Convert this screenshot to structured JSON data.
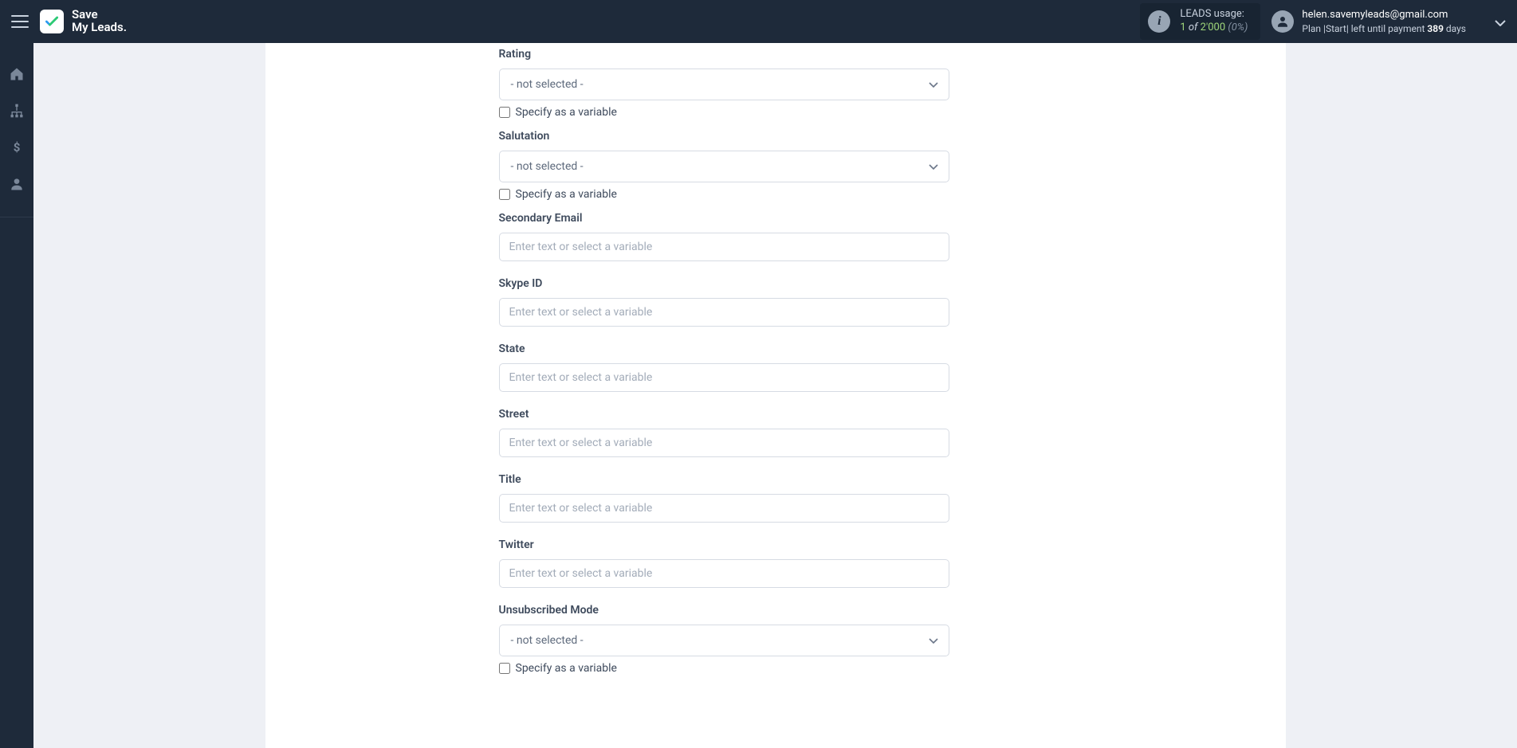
{
  "app": {
    "name_line1": "Save",
    "name_line2": "My Leads."
  },
  "header": {
    "usage_label": "LEADS usage:",
    "usage_current": "1",
    "usage_of": "of",
    "usage_total": "2'000",
    "usage_pct": "(0%)",
    "user_email": "helen.savemyleads@gmail.com",
    "plan_prefix": "Plan |",
    "plan_name": "Start",
    "plan_mid": "| left until payment ",
    "plan_days": "389",
    "plan_suffix": " days"
  },
  "form": {
    "placeholder_text": "Enter text or select a variable",
    "placeholder_dark": "Enter text",
    "placeholder_light": " or select a variable",
    "not_selected": "- not selected -",
    "specify_variable": "Specify as a variable",
    "fields": {
      "rating": "Rating",
      "salutation": "Salutation",
      "secondary_email": "Secondary Email",
      "skype_id": "Skype ID",
      "state": "State",
      "street": "Street",
      "title": "Title",
      "twitter": "Twitter",
      "unsubscribed_mode": "Unsubscribed Mode"
    }
  }
}
